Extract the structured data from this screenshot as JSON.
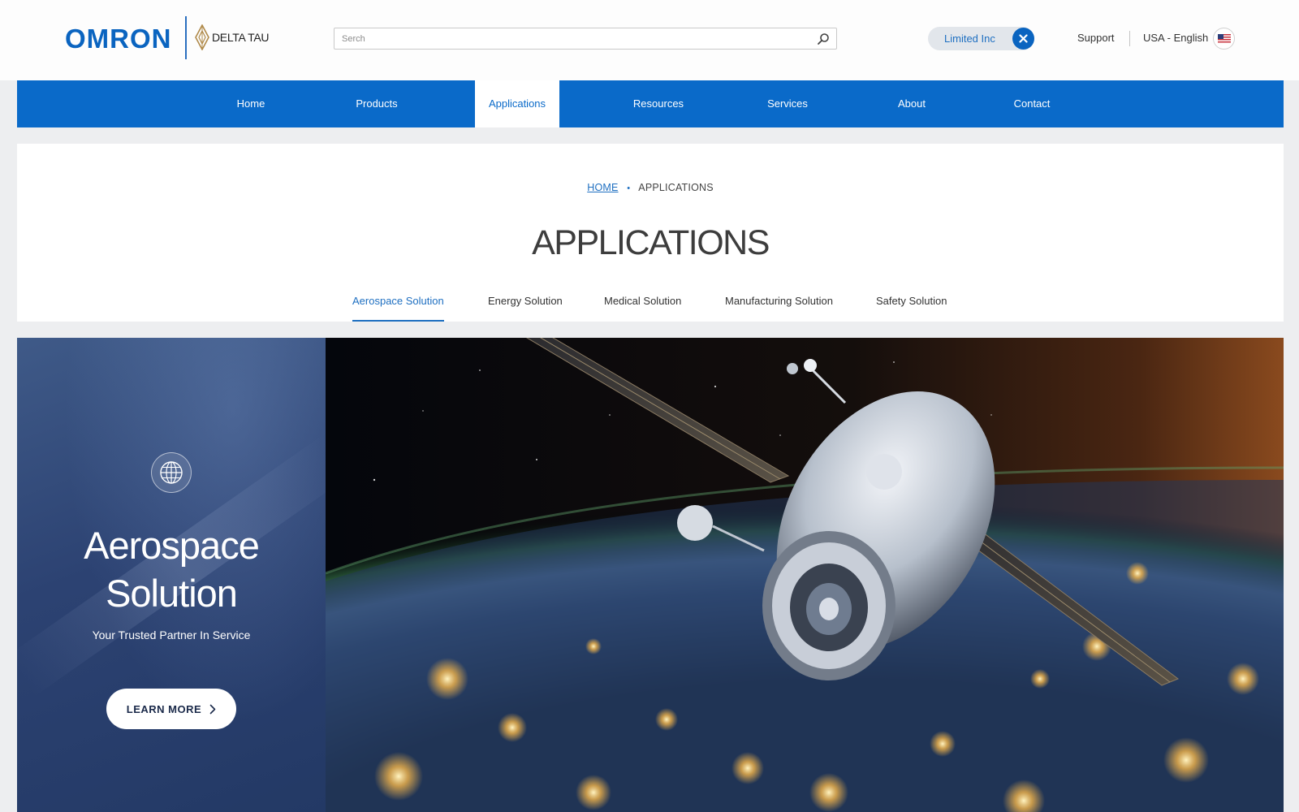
{
  "brand": {
    "logo_text": "OMRON",
    "sub_logo_text": "DELTA TAU",
    "primary_color": "#0a64c0",
    "nav_color": "#0a6ac9",
    "hero_panel_color": "#2c4272"
  },
  "header": {
    "search": {
      "placeholder": "Serch",
      "value": "",
      "icon": "search-icon"
    },
    "company_filter": {
      "label": "Limited Inc",
      "icon": "close-icon"
    },
    "support_label": "Support",
    "language_label": "USA - English",
    "flag_icon": "us-flag-icon"
  },
  "nav": {
    "items": [
      {
        "label": "Home"
      },
      {
        "label": "Products"
      },
      {
        "label": "Applications",
        "active": true
      },
      {
        "label": "Resources"
      },
      {
        "label": "Services"
      },
      {
        "label": "About"
      },
      {
        "label": "Contact"
      }
    ]
  },
  "breadcrumb": {
    "home": "HOME",
    "current": "APPLICATIONS"
  },
  "page": {
    "title": "APPLICATIONS"
  },
  "tabs": [
    {
      "label": "Aerospace Solution",
      "active": true
    },
    {
      "label": "Energy Solution"
    },
    {
      "label": "Medical Solution"
    },
    {
      "label": "Manufacturing Solution"
    },
    {
      "label": "Safety Solution"
    }
  ],
  "hero": {
    "icon": "globe-icon",
    "title_line1": "Aerospace",
    "title_line2": "Solution",
    "subtitle": "Your Trusted Partner In Service",
    "cta_label": "LEARN MORE",
    "cta_icon": "chevron-right-icon"
  }
}
